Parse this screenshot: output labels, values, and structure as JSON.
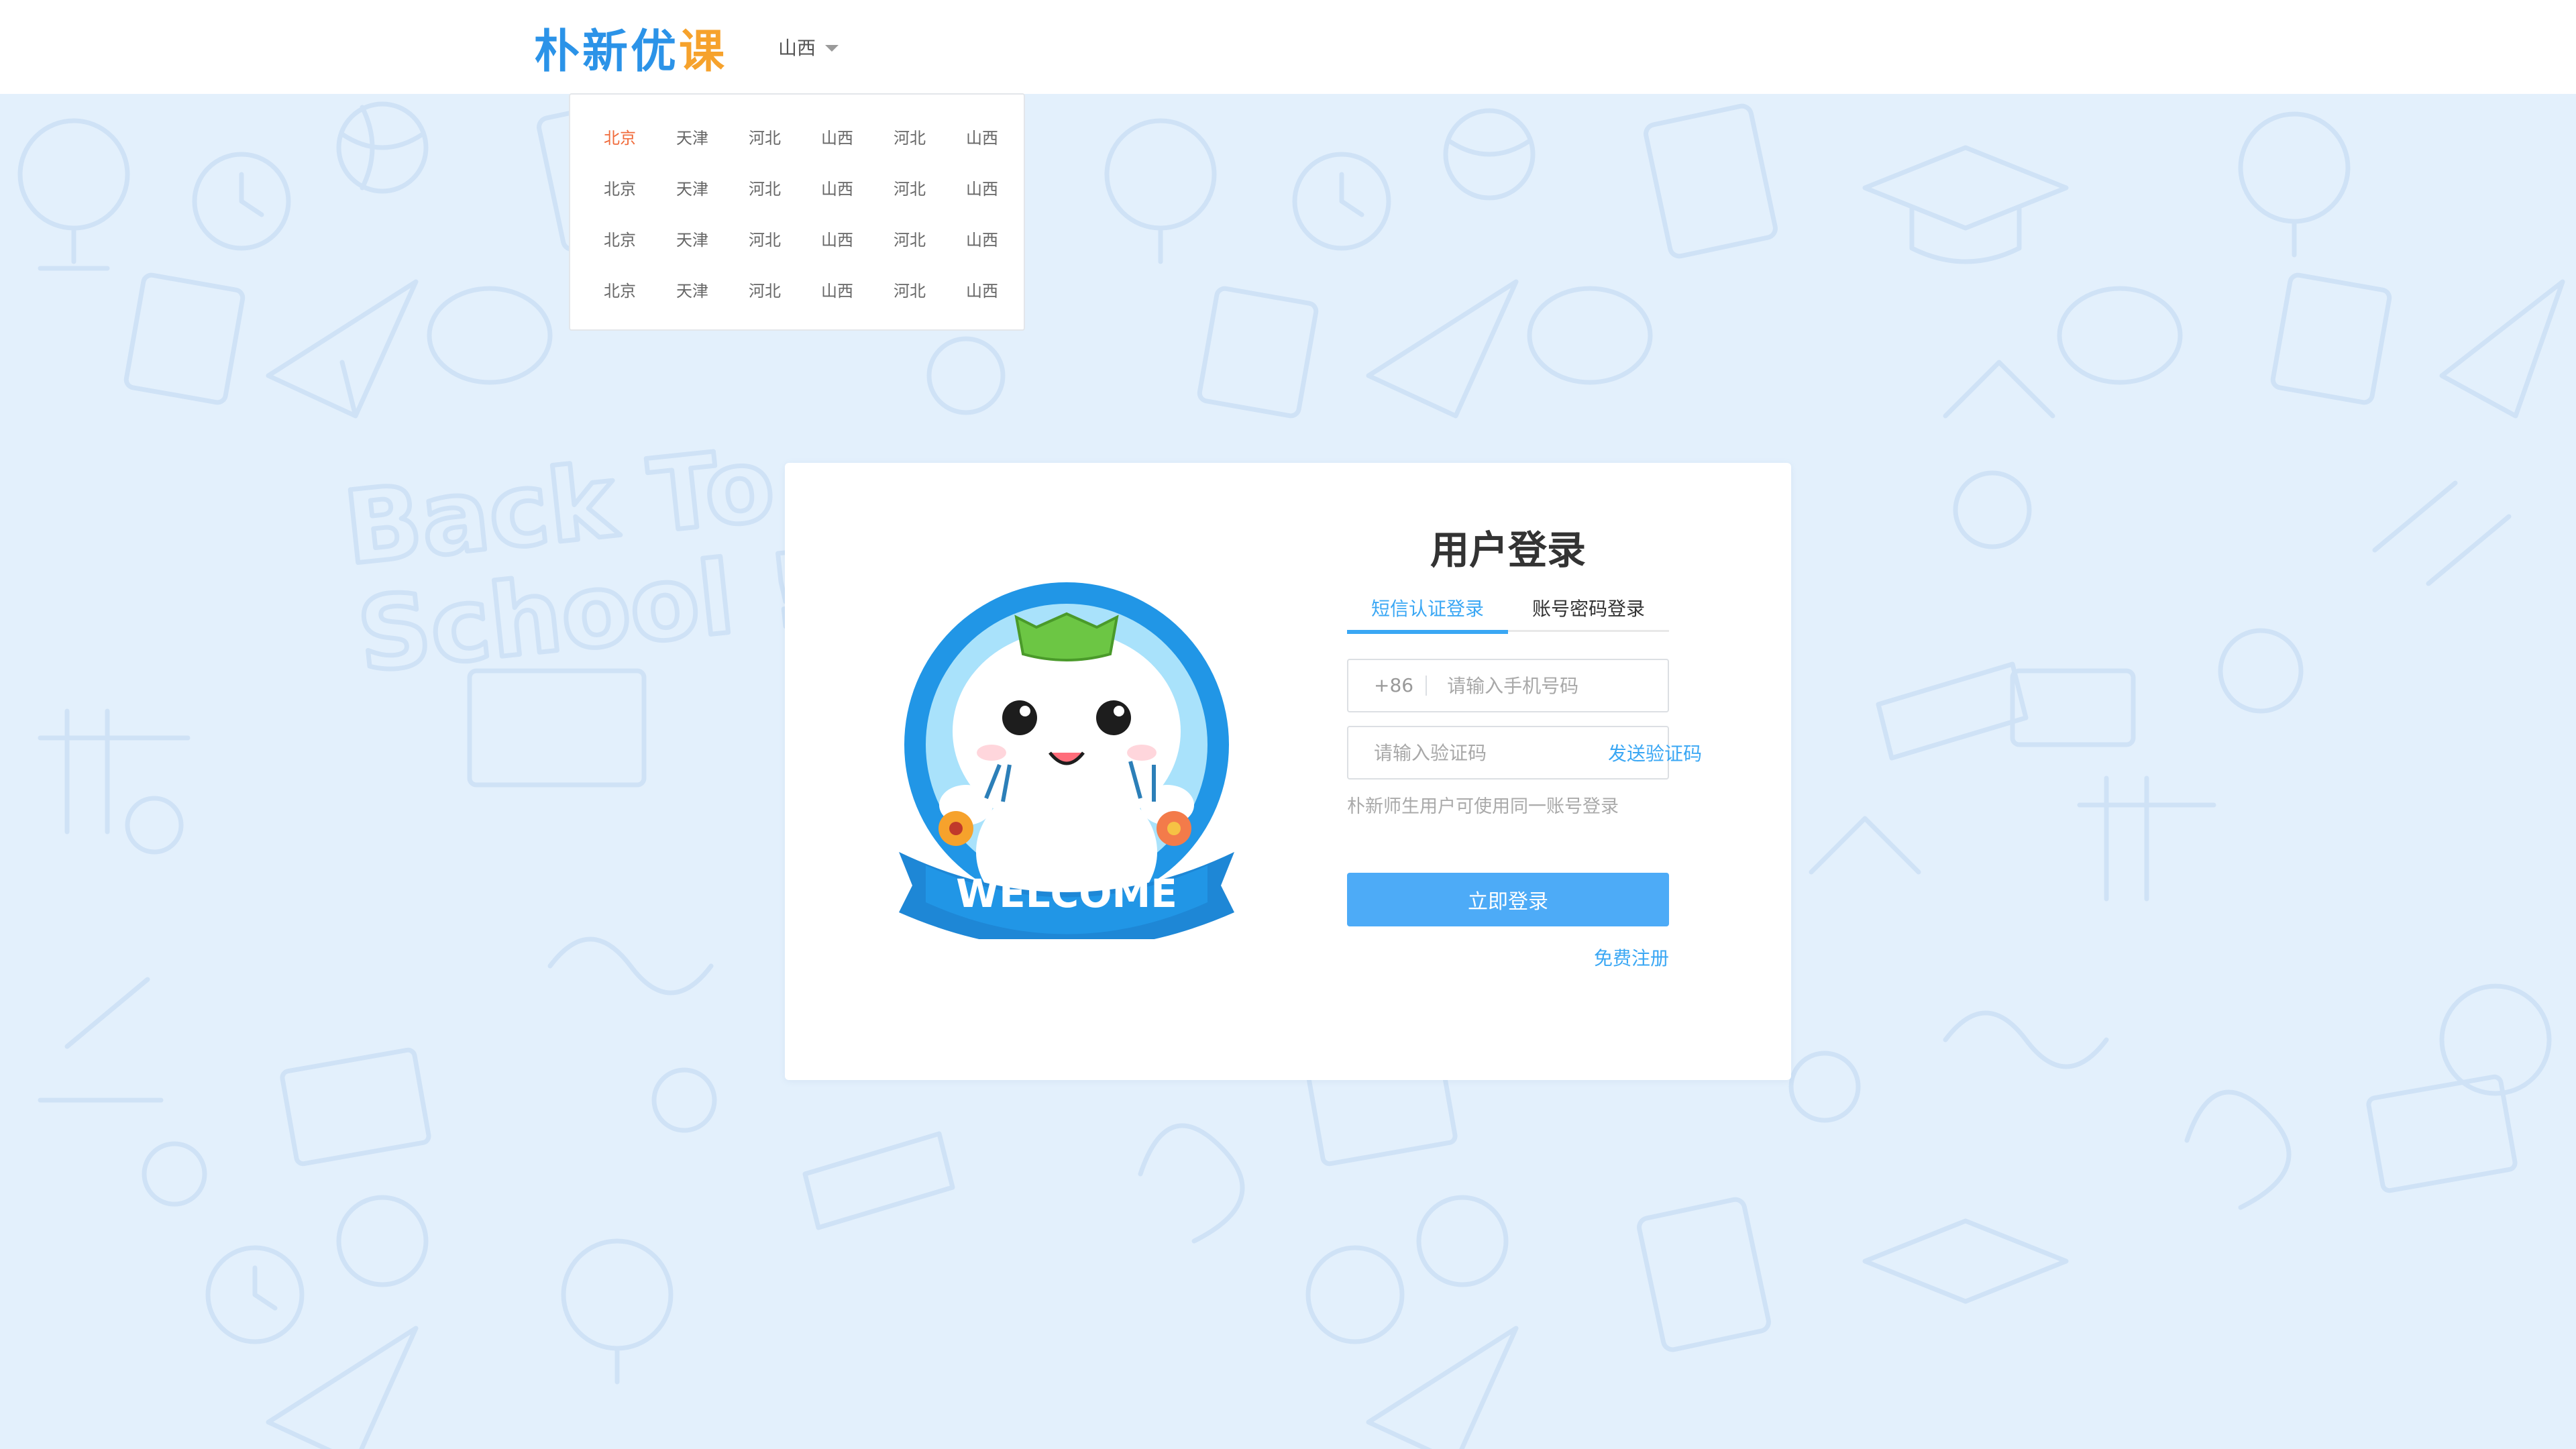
{
  "header": {
    "logo_main": "朴新优",
    "logo_accent": "课",
    "region_selected": "山西"
  },
  "region_panel": {
    "rows": [
      [
        "北京",
        "天津",
        "河北",
        "山西",
        "河北",
        "山西"
      ],
      [
        "北京",
        "天津",
        "河北",
        "山西",
        "河北",
        "山西"
      ],
      [
        "北京",
        "天津",
        "河北",
        "山西",
        "河北",
        "山西"
      ],
      [
        "北京",
        "天津",
        "河北",
        "山西",
        "河北",
        "山西"
      ]
    ],
    "active_index": 0
  },
  "login": {
    "title": "用户登录",
    "tabs": [
      "短信认证登录",
      "账号密码登录"
    ],
    "active_tab": 0,
    "phone_prefix": "+86",
    "phone_placeholder": "请输入手机号码",
    "code_placeholder": "请输入验证码",
    "send_code_label": "发送验证码",
    "hint": "朴新师生用户可使用同一账号登录",
    "submit_label": "立即登录",
    "register_label": "免费注册"
  },
  "mascot": {
    "banner_text": "WELCOME"
  },
  "colors": {
    "brand_blue": "#2b93e8",
    "accent_orange": "#f6a22c",
    "active_region": "#f06a3a",
    "button_blue": "#4dabf7",
    "background": "#e3f0fc"
  }
}
